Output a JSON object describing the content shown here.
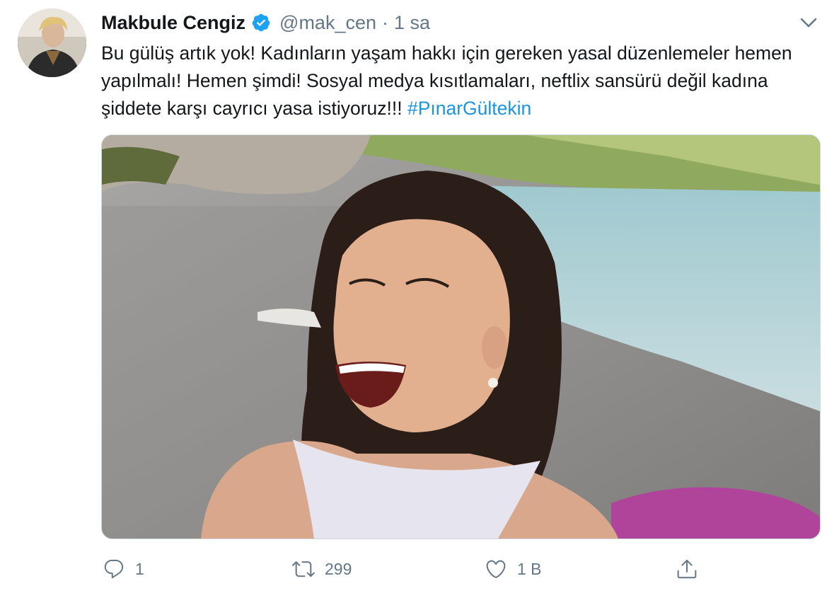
{
  "tweet": {
    "author": {
      "name": "Makbule Cengiz",
      "handle": "@mak_cen",
      "avatar_icon": "profile-photo",
      "verified_icon": "verified-badge-icon"
    },
    "separator": "·",
    "timestamp": "1 sa",
    "text": {
      "body": "Bu gülüş artık yok! Kadınların yaşam hakkı için gereken yasal düzenlemeler hemen yapılmalı! Hemen şimdi! Sosyal medya kısıtlamaları, neftlix sansürü değil kadına şiddete karşı cayrıcı yasa istiyoruz!!! ",
      "hashtag": "#PınarGültekin"
    },
    "media": {
      "type": "photo"
    },
    "actions": {
      "reply": {
        "icon": "reply-icon",
        "count": "1"
      },
      "retweet": {
        "icon": "retweet-icon",
        "count": "299"
      },
      "like": {
        "icon": "heart-icon",
        "count": "1 B"
      },
      "share": {
        "icon": "share-icon"
      }
    }
  },
  "colors": {
    "text": "#14171a",
    "secondary": "#657786",
    "link": "#1b95e0",
    "verified": "#1da1f2",
    "border": "#ccd6dd"
  }
}
